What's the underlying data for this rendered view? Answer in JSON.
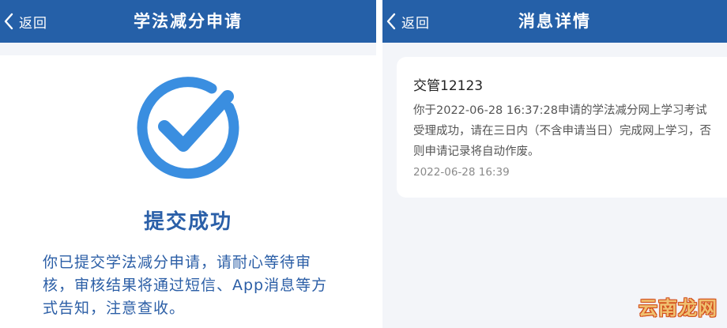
{
  "left_screen": {
    "navbar": {
      "back_label": "返回",
      "title": "学法减分申请"
    },
    "status": {
      "icon": "checkmark-circle-icon",
      "title": "提交成功",
      "description": "你已提交学法减分申请，请耐心等待审核，审核结果将通过短信、App消息等方式告知，注意查收。"
    }
  },
  "right_screen": {
    "navbar": {
      "back_label": "返回",
      "title": "消息详情"
    },
    "message": {
      "sender": "交管12123",
      "body": "你于2022-06-28 16:37:28申请的学法减分网上学习考试受理成功，请在三日内（不含申请当日）完成网上学习，否则申请记录将自动作废。",
      "time": "2022-06-28 16:39"
    }
  },
  "watermark": "云南龙网",
  "colors": {
    "navbar": "#2560a8",
    "accent_blue": "#2a5fa8",
    "icon_blue": "#3a8ee0"
  }
}
